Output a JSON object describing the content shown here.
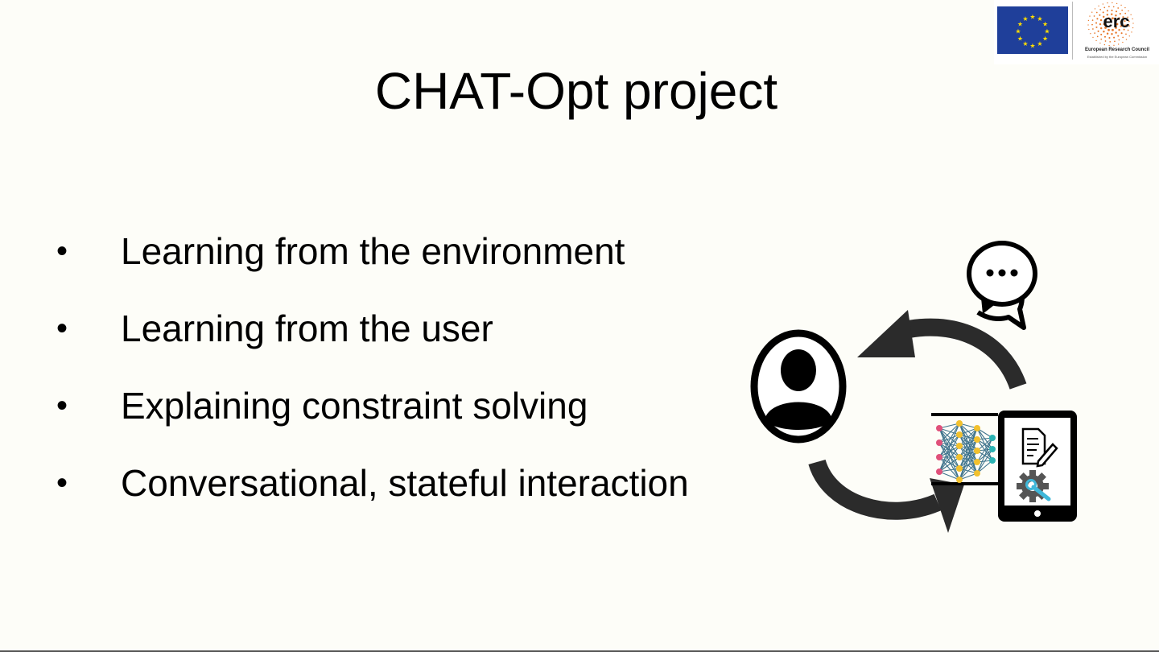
{
  "slide": {
    "title": "CHAT-Opt project",
    "bullets": [
      "Learning from the environment",
      "Learning from the user",
      "Explaining constraint solving",
      "Conversational, stateful interaction"
    ]
  },
  "logos": {
    "erc_wordmark": "erc",
    "erc_name": "European Research Council",
    "erc_subtitle": "Established by the European Commission"
  },
  "diagram": {
    "icons": [
      "user-icon",
      "chat-bubbles-icon",
      "neural-network-icon",
      "tablet-icon",
      "document-edit-icon",
      "gear-wrench-icon",
      "cycle-arrows"
    ]
  },
  "colors": {
    "background": "#fdfdf8",
    "eu_blue": "#1f3f9a",
    "eu_star": "#ffdd00",
    "erc_orange": "#e8792b",
    "nn_pink": "#e0507a",
    "nn_yellow": "#f2c12e",
    "nn_teal": "#2ab3b3",
    "wrench_blue": "#3fb7d9"
  }
}
